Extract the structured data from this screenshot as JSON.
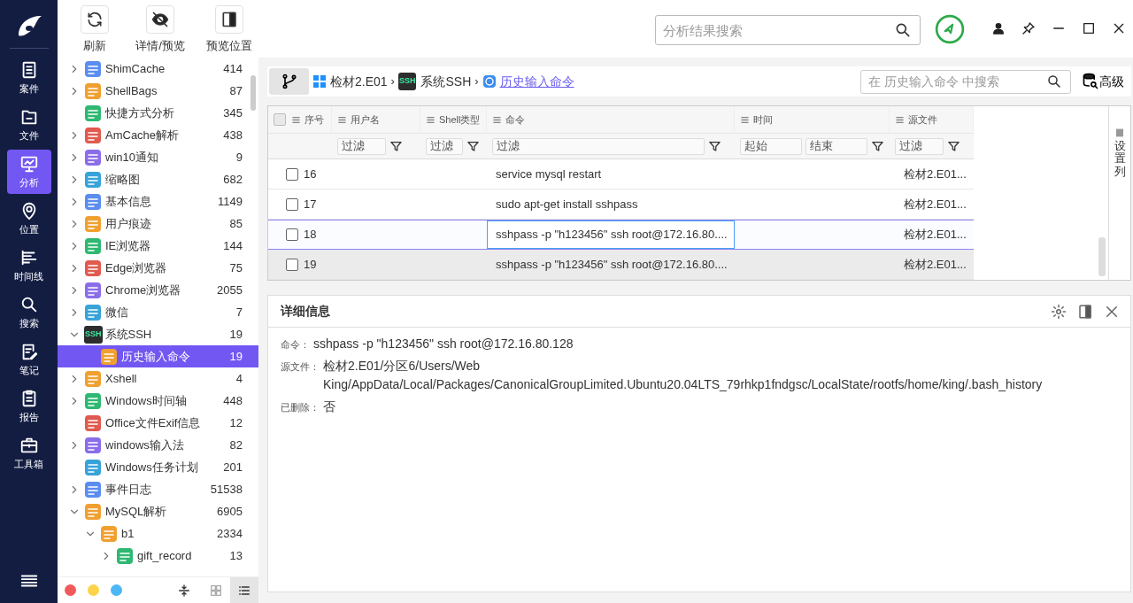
{
  "nav": {
    "items": [
      {
        "label": "案件",
        "selected": false
      },
      {
        "label": "文件",
        "selected": false
      },
      {
        "label": "分析",
        "selected": true
      },
      {
        "label": "位置",
        "selected": false
      },
      {
        "label": "时间线",
        "selected": false
      },
      {
        "label": "搜索",
        "selected": false
      },
      {
        "label": "笔记",
        "selected": false
      },
      {
        "label": "报告",
        "selected": false
      },
      {
        "label": "工具箱",
        "selected": false
      }
    ]
  },
  "toolbar": {
    "buttons": [
      "刷新",
      "详情/预览",
      "预览位置"
    ]
  },
  "search": {
    "placeholder": "分析结果搜索"
  },
  "tree": {
    "items": [
      {
        "label": "ShimCache",
        "count": "414",
        "expanded": false,
        "selected": false
      },
      {
        "label": "ShellBags",
        "count": "87",
        "expanded": false,
        "selected": false
      },
      {
        "label": "快捷方式分析",
        "count": "345",
        "selected": false
      },
      {
        "label": "AmCache解析",
        "count": "438",
        "expanded": false,
        "selected": false
      },
      {
        "label": "win10通知",
        "count": "9",
        "expanded": false,
        "selected": false
      },
      {
        "label": "缩略图",
        "count": "682",
        "expanded": false,
        "selected": false
      },
      {
        "label": "基本信息",
        "count": "1149",
        "expanded": false,
        "selected": false
      },
      {
        "label": "用户痕迹",
        "count": "85",
        "expanded": false,
        "selected": false
      },
      {
        "label": "IE浏览器",
        "count": "144",
        "expanded": false,
        "selected": false
      },
      {
        "label": "Edge浏览器",
        "count": "75",
        "expanded": false,
        "selected": false
      },
      {
        "label": "Chrome浏览器",
        "count": "2055",
        "expanded": false,
        "selected": false
      },
      {
        "label": "微信",
        "count": "7",
        "expanded": false,
        "selected": false
      },
      {
        "label": "系统SSH",
        "count": "19",
        "expanded": true,
        "selected": false,
        "icon_text": "SSH",
        "children": [
          {
            "label": "历史输入命令",
            "count": "19",
            "selected": true
          }
        ]
      },
      {
        "label": "Xshell",
        "count": "4",
        "expanded": false,
        "selected": false
      },
      {
        "label": "Windows时间轴",
        "count": "448",
        "expanded": false,
        "selected": false
      },
      {
        "label": "Office文件Exif信息",
        "count": "12",
        "selected": false
      },
      {
        "label": "windows输入法",
        "count": "82",
        "expanded": false,
        "selected": false
      },
      {
        "label": "Windows任务计划",
        "count": "201",
        "selected": false
      },
      {
        "label": "事件日志",
        "count": "51538",
        "expanded": false,
        "selected": false
      },
      {
        "label": "MySQL解析",
        "count": "6905",
        "expanded": true,
        "selected": false,
        "children": [
          {
            "label": "b1",
            "count": "2334",
            "expanded": true,
            "selected": false,
            "children": [
              {
                "label": "gift_record",
                "count": "13",
                "expanded": false,
                "selected": false
              }
            ]
          }
        ]
      }
    ]
  },
  "tree_footer": {
    "dots": [
      {
        "color": "#f25a5a"
      },
      {
        "color": "#fdd34a"
      },
      {
        "color": "#4db6f5"
      }
    ],
    "views": [
      {
        "selected": false
      },
      {
        "selected": true
      }
    ]
  },
  "breadcrumb": [
    {
      "label": "检材2.E01",
      "link": false
    },
    {
      "separator": "›",
      "label": "系统SSH",
      "link": false,
      "icon_text": "SSH"
    },
    {
      "separator": "›",
      "label": "历史输入命令",
      "link": true
    }
  ],
  "table_search": {
    "placeholder": "在 历史输入命令 中搜索"
  },
  "advanced_button": "高级",
  "table": {
    "all_checked": false,
    "columns": [
      {
        "label": "序号"
      },
      {
        "label": "用户名",
        "filters": [
          {
            "placeholder": "过滤"
          }
        ]
      },
      {
        "label": "Shell类型",
        "filters": [
          {
            "placeholder": "过滤"
          }
        ]
      },
      {
        "label": "命令",
        "filters": [
          {
            "placeholder": "过滤"
          }
        ]
      },
      {
        "label": "时间",
        "filters": [
          {
            "placeholder": "起始"
          },
          {
            "placeholder": "结束"
          }
        ]
      },
      {
        "label": "源文件",
        "filters": [
          {
            "placeholder": "过滤"
          }
        ]
      }
    ],
    "rows": [
      {
        "index": "16",
        "command": "service mysql restart",
        "source": "检材2.E01...",
        "checked": false,
        "selected": false,
        "focused": false
      },
      {
        "index": "17",
        "command": "sudo apt-get install sshpass",
        "source": "检材2.E01...",
        "checked": false,
        "selected": false,
        "focused": false
      },
      {
        "index": "18",
        "command": "sshpass -p \"h123456\" ssh root@172.16.80....",
        "source": "检材2.E01...",
        "checked": false,
        "selected": false,
        "focused": true
      },
      {
        "index": "19",
        "command": "sshpass -p \"h123456\" ssh root@172.16.80....",
        "source": "检材2.E01...",
        "checked": false,
        "selected": true,
        "focused": false
      }
    ]
  },
  "column_settings": "设置列",
  "detail": {
    "title": "详细信息",
    "fields": [
      {
        "label": "命令：",
        "value": "sshpass -p \"h123456\" ssh root@172.16.80.128"
      },
      {
        "label": "源文件：",
        "value": "检材2.E01/分区6/Users/Web King/AppData/Local/Packages/CanonicalGroupLimited.Ubuntu20.04LTS_79rhkp1fndgsc/LocalState/rootfs/home/king/.bash_history"
      },
      {
        "label": "已删除：",
        "value": "否"
      }
    ]
  }
}
